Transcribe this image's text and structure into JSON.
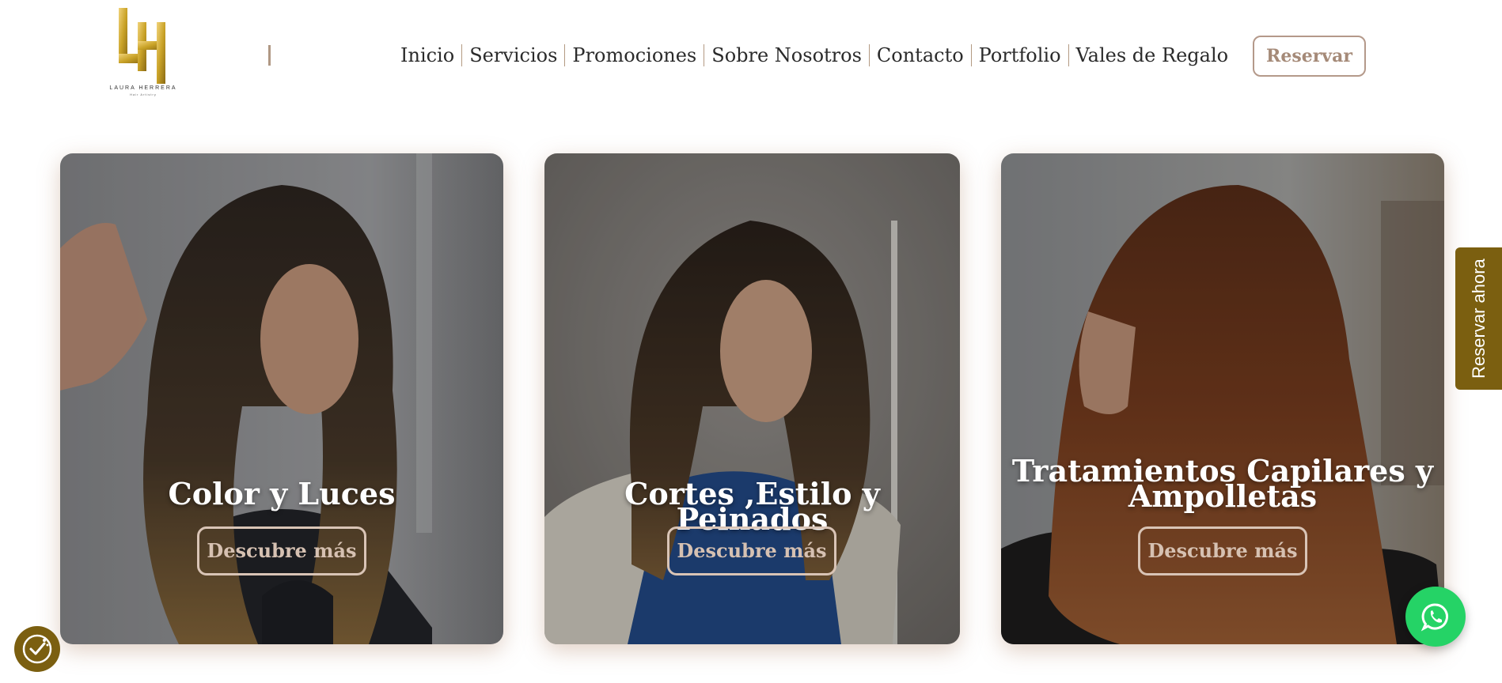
{
  "brand": {
    "logo_monogram": "LH",
    "logo_text": "LAURA HERRERA",
    "logo_subtext": "Hair Artistry",
    "accent_color": "#7b5f10",
    "gold_color": "#c9a227"
  },
  "nav": {
    "items": [
      {
        "label": "Inicio"
      },
      {
        "label": "Servicios"
      },
      {
        "label": "Promociones"
      },
      {
        "label": "Sobre Nosotros"
      },
      {
        "label": "Contacto"
      },
      {
        "label": "Portfolio"
      },
      {
        "label": "Vales de Regalo"
      }
    ],
    "reserve_label": "Reservar"
  },
  "cards": [
    {
      "title": "Color y Luces",
      "button": "Descubre más"
    },
    {
      "title": "Cortes ,Estilo y Peinados",
      "button": "Descubre más"
    },
    {
      "title_line1": "Tratamientos Capilares y",
      "title_line2": "Ampolletas",
      "button": "Descubre más"
    }
  ],
  "side_tab": {
    "label": "Reservar ahora"
  },
  "icons": {
    "whatsapp": "whatsapp-icon",
    "cookie": "cookie-settings-icon",
    "whatsapp_color": "#25d366"
  }
}
